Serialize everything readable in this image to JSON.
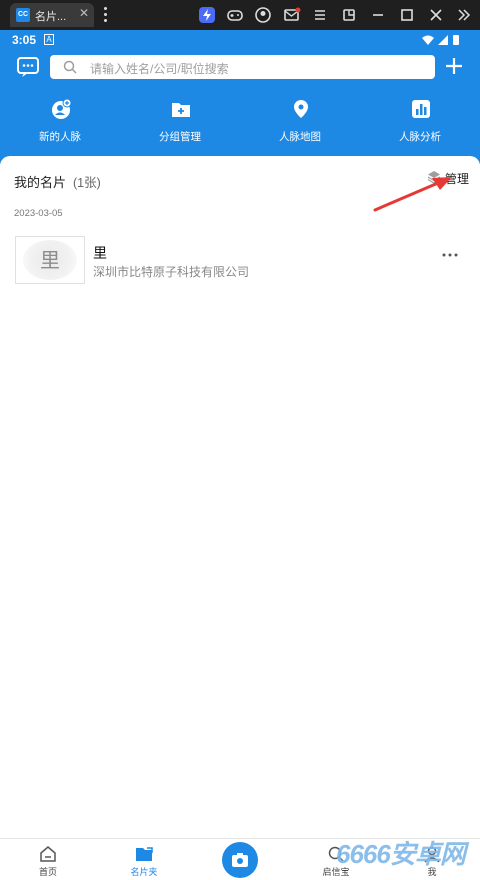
{
  "emulator": {
    "tab_title": "名片...",
    "tab_logo": "CC",
    "tab_close": "✕",
    "icons": [
      "lightning-icon",
      "gamepad-icon",
      "account-icon",
      "mail-icon",
      "menu-icon",
      "rotate-icon",
      "minimize-icon",
      "maximize-icon",
      "close-icon",
      "expand-icon"
    ]
  },
  "status_bar": {
    "time": "3:05",
    "indicator": "A"
  },
  "header": {
    "search_placeholder": "请输入姓名/公司/职位搜索",
    "quick_actions": [
      {
        "label": "新的人脉",
        "icon": "new-contacts-icon"
      },
      {
        "label": "分组管理",
        "icon": "group-folder-icon"
      },
      {
        "label": "人脉地图",
        "icon": "map-pin-icon"
      },
      {
        "label": "人脉分析",
        "icon": "bar-chart-icon"
      }
    ]
  },
  "cards": {
    "title": "我的名片",
    "count": "(1张)",
    "manage_label": "管理",
    "date": "2023-03-05",
    "items": [
      {
        "thumb_char": "里",
        "name": "里",
        "company": "深圳市比特原子科技有限公司"
      }
    ]
  },
  "bottom_nav": {
    "items": [
      {
        "label": "首页",
        "icon": "home-icon"
      },
      {
        "label": "名片夹",
        "icon": "card-folder-icon",
        "active": true
      },
      {
        "label": "",
        "icon": "camera-icon"
      },
      {
        "label": "启信宝",
        "icon": "search-circle-icon"
      },
      {
        "label": "我",
        "icon": "profile-icon"
      }
    ]
  },
  "watermark": "6666安卓网",
  "colors": {
    "primary": "#1e88e5",
    "annotation_arrow": "#e53935"
  }
}
